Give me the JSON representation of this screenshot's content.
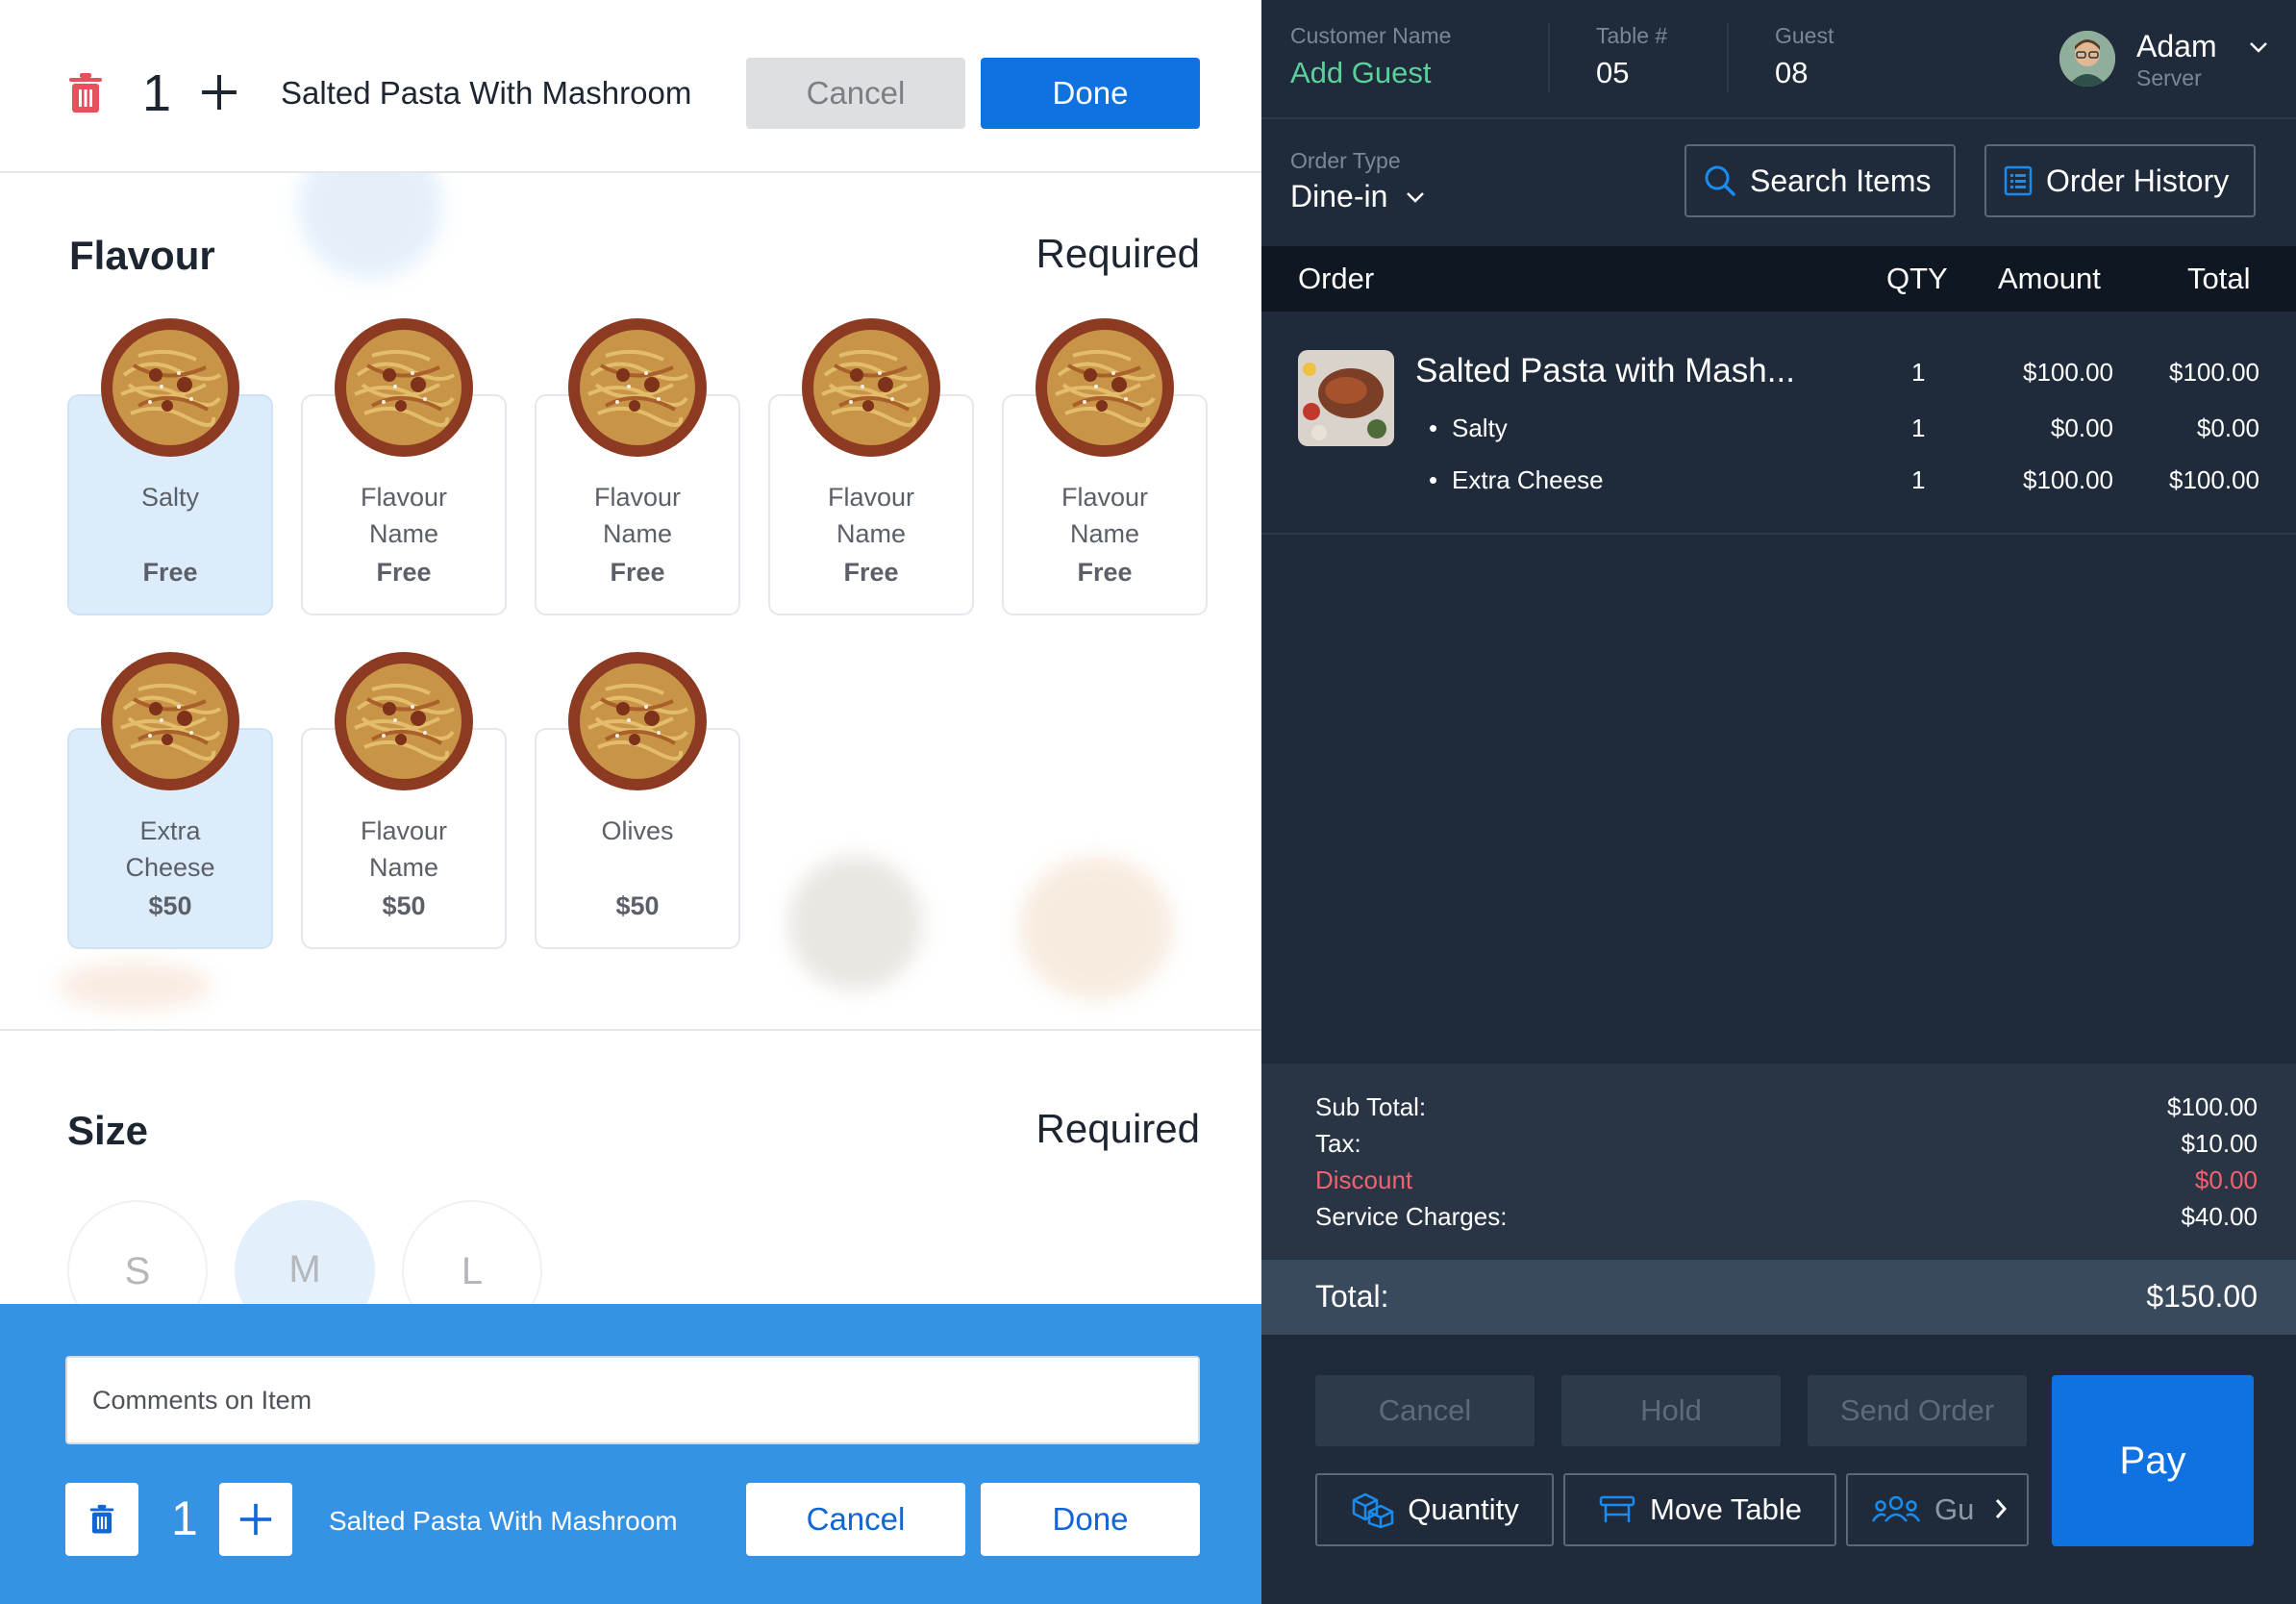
{
  "colors": {
    "accent": "#0f72e0",
    "add_guest": "#5ad09a",
    "discount": "#f0626e",
    "panel_dark": "#1f2b3a",
    "selected_card": "#dcecfb"
  },
  "editor": {
    "quantity": "1",
    "item_name": "Salted Pasta With Mashroom",
    "cancel_label": "Cancel",
    "done_label": "Done"
  },
  "flavour": {
    "title": "Flavour",
    "required": "Required",
    "options": [
      {
        "line1": "Salty",
        "line2": "",
        "price": "Free",
        "selected": true
      },
      {
        "line1": "Flavour",
        "line2": "Name",
        "price": "Free",
        "selected": false
      },
      {
        "line1": "Flavour",
        "line2": "Name",
        "price": "Free",
        "selected": false
      },
      {
        "line1": "Flavour",
        "line2": "Name",
        "price": "Free",
        "selected": false
      },
      {
        "line1": "Flavour",
        "line2": "Name",
        "price": "Free",
        "selected": false
      },
      {
        "line1": "Extra",
        "line2": "Cheese",
        "price": "$50",
        "selected": true
      },
      {
        "line1": "Flavour",
        "line2": "Name",
        "price": "$50",
        "selected": false
      },
      {
        "line1": "Olives",
        "line2": "",
        "price": "$50",
        "selected": false
      }
    ]
  },
  "size": {
    "title": "Size",
    "required": "Required",
    "options": [
      "S",
      "M",
      "L"
    ],
    "selected": "M"
  },
  "bottom": {
    "comments_placeholder": "Comments on Item",
    "quantity": "1",
    "item_name": "Salted Pasta With Mashroom",
    "cancel_label": "Cancel",
    "done_label": "Done"
  },
  "header": {
    "customer_label": "Customer Name",
    "customer_value": "Add Guest",
    "table_label": "Table #",
    "table_value": "05",
    "guest_label": "Guest",
    "guest_value": "08",
    "user_name": "Adam",
    "user_role": "Server"
  },
  "order_type": {
    "label": "Order Type",
    "value": "Dine-in"
  },
  "toolbar": {
    "search_label": "Search Items",
    "history_label": "Order History"
  },
  "order_table": {
    "headers": {
      "order": "Order",
      "qty": "QTY",
      "amount": "Amount",
      "total": "Total"
    },
    "item": {
      "name": "Salted Pasta with Mash...",
      "qty": "1",
      "amount": "$100.00",
      "total": "$100.00"
    },
    "modifiers": [
      {
        "name": "Salty",
        "qty": "1",
        "amount": "$0.00",
        "total": "$0.00"
      },
      {
        "name": "Extra Cheese",
        "qty": "1",
        "amount": "$100.00",
        "total": "$100.00"
      }
    ]
  },
  "summary": {
    "subtotal_label": "Sub Total:",
    "subtotal": "$100.00",
    "tax_label": "Tax:",
    "tax": "$10.00",
    "discount_label": "Discount",
    "discount": "$0.00",
    "service_label": "Service Charges:",
    "service": "$40.00",
    "total_label": "Total:",
    "total": "$150.00"
  },
  "actions": {
    "cancel": "Cancel",
    "hold": "Hold",
    "send": "Send Order",
    "quantity": "Quantity",
    "move_table": "Move Table",
    "guest": "Gu",
    "pay": "Pay"
  }
}
